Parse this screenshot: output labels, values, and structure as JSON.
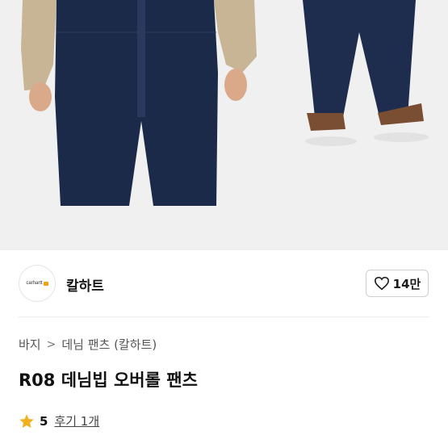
{
  "hero": {
    "image": "product-photo-denim-overalls"
  },
  "brand": {
    "logo_text": "carhartt",
    "name": "칼하트",
    "likes": "14만"
  },
  "breadcrumb": {
    "items": [
      "바지",
      "데님 팬츠 (칼하트)"
    ]
  },
  "product": {
    "title": "R08 데님빕 오버롤 팬츠",
    "rating": "5",
    "reviews": "후기 1개"
  },
  "colors": {
    "denim": "#1c2a4a",
    "shirt": "#c9b89b",
    "star": "#f2b01e"
  }
}
